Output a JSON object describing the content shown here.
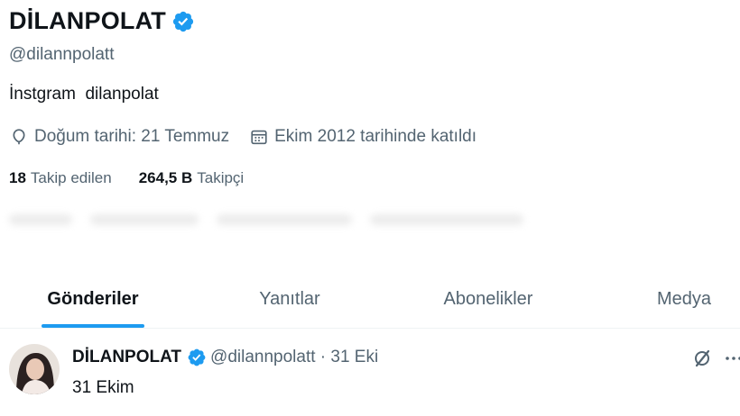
{
  "profile": {
    "display_name": "DİLANPOLAT",
    "handle": "@dilannpolatt",
    "bio": "İnstgram  dilanpolat",
    "birthday": "Doğum tarihi: 21 Temmuz",
    "joined": "Ekim 2012 tarihinde katıldı",
    "following_count": "18",
    "following_label": "Takip edilen",
    "followers_count": "264,5 B",
    "followers_label": "Takipçi"
  },
  "tabs": [
    {
      "label": "Gönderiler",
      "active": true
    },
    {
      "label": "Yanıtlar",
      "active": false
    },
    {
      "label": "Abonelikler",
      "active": false
    },
    {
      "label": "Medya",
      "active": false
    }
  ],
  "tweet": {
    "author_name": "DİLANPOLAT",
    "author_handle_date": "@dilannpolatt · 31 Eki",
    "text": "31 Ekim"
  },
  "icons": {
    "verified": "verified-badge-icon",
    "birthday": "balloon-icon",
    "joined": "calendar-icon",
    "grok": "grok-icon",
    "more": "more-icon"
  },
  "colors": {
    "accent": "#1d9bf0",
    "text_primary": "#0f1419",
    "text_secondary": "#536471"
  }
}
